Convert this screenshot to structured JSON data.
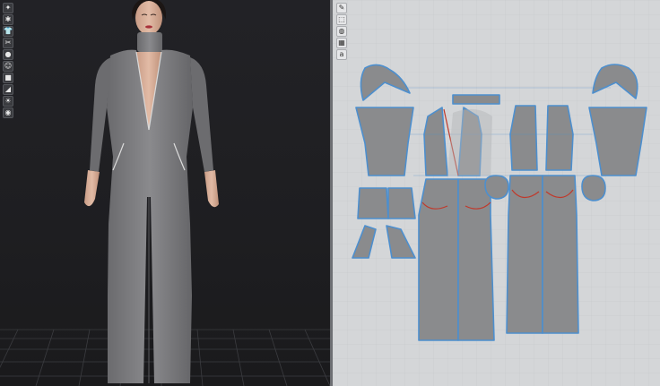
{
  "app": {
    "views": [
      "3D Garment",
      "2D Pattern"
    ]
  },
  "toolbar_3d": [
    {
      "icon": "simulation-icon",
      "glyph": "✦"
    },
    {
      "icon": "gear-icon",
      "glyph": "✱"
    },
    {
      "icon": "shirt-icon",
      "glyph": "👕"
    },
    {
      "icon": "thread-icon",
      "glyph": "✂"
    },
    {
      "icon": "pin-icon",
      "glyph": "●"
    },
    {
      "icon": "avatar-icon",
      "glyph": "☺"
    },
    {
      "icon": "texture-icon",
      "glyph": "■"
    },
    {
      "icon": "fold-icon",
      "glyph": "◢"
    },
    {
      "icon": "light-icon",
      "glyph": "☀"
    },
    {
      "icon": "globe-icon",
      "glyph": "◉"
    }
  ],
  "toolbar_2d": [
    {
      "icon": "edit-pattern-icon",
      "glyph": "✎"
    },
    {
      "icon": "transform-icon",
      "glyph": "⬚"
    },
    {
      "icon": "sewing-icon",
      "glyph": "◍"
    },
    {
      "icon": "measure-icon",
      "glyph": "▦"
    },
    {
      "icon": "text-icon",
      "glyph": "a"
    }
  ],
  "colors": {
    "fabric": "#7a7a7c",
    "fabric_dark": "#5f6063",
    "pattern_fill": "#8a8b8d",
    "pattern_outline": "#4d8fce",
    "seam_line": "#c0392b",
    "grid": "#c4c7ca"
  }
}
